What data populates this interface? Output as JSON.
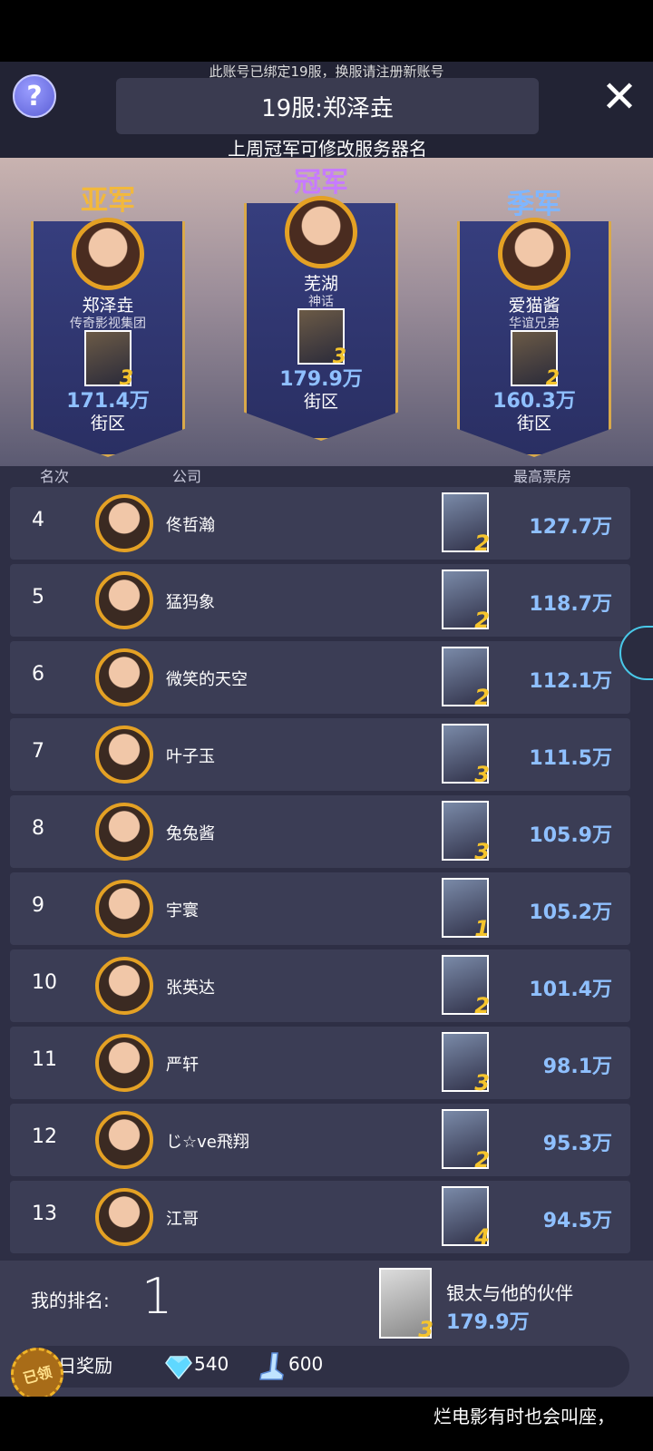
{
  "header": {
    "notice": "此账号已绑定19服，换服请注册新账号",
    "server_title": "19服:郑泽垚",
    "server_sub": "上周冠军可修改服务器名",
    "help_glyph": "?",
    "close_glyph": "✕"
  },
  "podium": {
    "second": {
      "title": "亚军",
      "name": "郑泽垚",
      "company": "传奇影视集团",
      "level": "3",
      "value": "171.4万",
      "genre": "街区"
    },
    "first": {
      "title": "冠军",
      "name": "芜湖",
      "company": "神话",
      "level": "3",
      "value": "179.9万",
      "genre": "街区"
    },
    "third": {
      "title": "季军",
      "name": "爱猫酱",
      "company": "华谊兄弟",
      "level": "2",
      "value": "160.3万",
      "genre": "街区"
    }
  },
  "columns": {
    "rank": "名次",
    "company": "公司",
    "box_office": "最高票房"
  },
  "rows": [
    {
      "rank": "4",
      "name": "佟哲瀚",
      "level": "2",
      "value": "127.7万"
    },
    {
      "rank": "5",
      "name": "猛犸象",
      "level": "2",
      "value": "118.7万"
    },
    {
      "rank": "6",
      "name": "微笑的天空",
      "level": "2",
      "value": "112.1万"
    },
    {
      "rank": "7",
      "name": "叶子玉",
      "level": "3",
      "value": "111.5万"
    },
    {
      "rank": "8",
      "name": "兔兔酱",
      "level": "3",
      "value": "105.9万"
    },
    {
      "rank": "9",
      "name": "宇寰",
      "level": "1",
      "value": "105.2万"
    },
    {
      "rank": "10",
      "name": "张英达",
      "level": "2",
      "value": "101.4万"
    },
    {
      "rank": "11",
      "name": "严轩",
      "level": "3",
      "value": "98.1万"
    },
    {
      "rank": "12",
      "name": "じ☆ve飛翔",
      "level": "2",
      "value": "95.3万"
    },
    {
      "rank": "13",
      "name": "江哥",
      "level": "4",
      "value": "94.5万"
    }
  ],
  "mine": {
    "label": "我的排名:",
    "rank": "1",
    "level": "3",
    "title": "银太与他的伙伴",
    "value": "179.9万",
    "reward_label": "昨日奖励",
    "badge": "已领",
    "gems": "540",
    "boots": "600"
  },
  "ticker": "烂电影有时也会叫座，"
}
